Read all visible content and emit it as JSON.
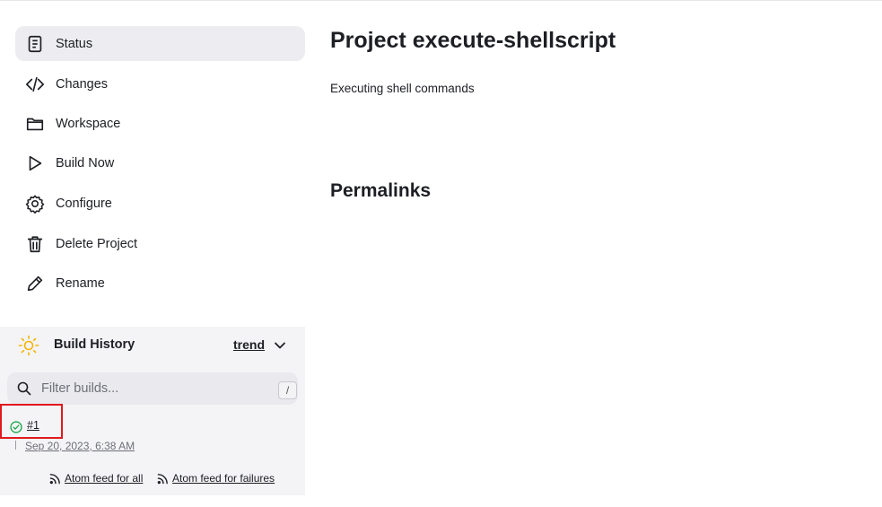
{
  "project": {
    "title": "Project execute-shellscript",
    "description": "Executing shell commands",
    "permalinks_heading": "Permalinks"
  },
  "sidebar": {
    "items": [
      {
        "label": "Status",
        "icon": "document-icon",
        "active": true
      },
      {
        "label": "Changes",
        "icon": "code-icon"
      },
      {
        "label": "Workspace",
        "icon": "folder-icon"
      },
      {
        "label": "Build Now",
        "icon": "play-icon"
      },
      {
        "label": "Configure",
        "icon": "gear-icon"
      },
      {
        "label": "Delete Project",
        "icon": "trash-icon"
      },
      {
        "label": "Rename",
        "icon": "pencil-icon"
      }
    ]
  },
  "build_history": {
    "title": "Build History",
    "trend_label": "trend",
    "filter_placeholder": "Filter builds...",
    "shortcut_key": "/",
    "builds": [
      {
        "number": "#1",
        "date": "Sep 20, 2023, 6:38 AM",
        "status": "success"
      }
    ],
    "feeds": {
      "all_label": "Atom feed for all",
      "failures_label": "Atom feed for failures"
    }
  },
  "colors": {
    "success": "#1ea64b",
    "sun": "#f5b400",
    "highlight": "#e0191e"
  }
}
